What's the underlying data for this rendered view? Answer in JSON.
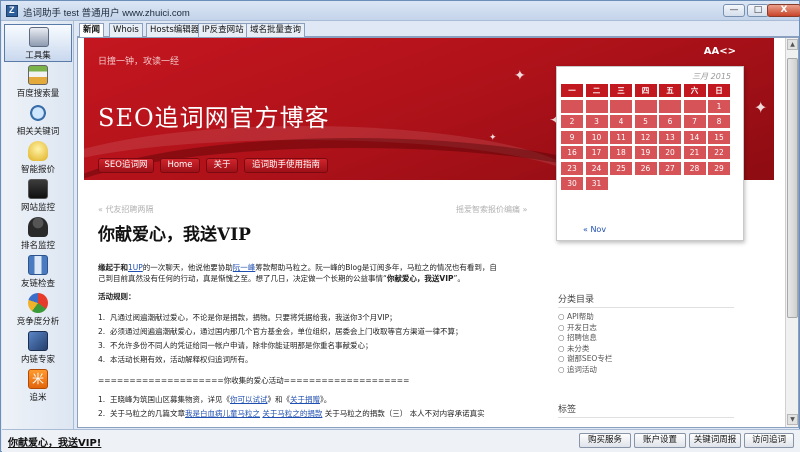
{
  "window": {
    "title": "追词助手 test 普通用户 www.zhuici.com",
    "controls": [
      "—",
      "□",
      "X"
    ]
  },
  "sidebar": {
    "items": [
      {
        "label": "工具集",
        "icon": "toolbox-icon"
      },
      {
        "label": "百度搜索量",
        "icon": "chart-icon"
      },
      {
        "label": "相关关键词",
        "icon": "magnifier-icon"
      },
      {
        "label": "智能报价",
        "icon": "lightbulb-icon"
      },
      {
        "label": "网站监控",
        "icon": "monitor-icon"
      },
      {
        "label": "排名监控",
        "icon": "user-icon"
      },
      {
        "label": "友链检查",
        "icon": "network-icon"
      },
      {
        "label": "竞争度分析",
        "icon": "pie-icon"
      },
      {
        "label": "内链专家",
        "icon": "links-icon"
      },
      {
        "label": "追米",
        "icon": "rice-icon"
      }
    ]
  },
  "tabs": [
    "新闻",
    "Whois",
    "Hosts编辑器",
    "IP反查网站",
    "域名批量查询"
  ],
  "blog": {
    "slogan": "日撞一钟，攻读一经",
    "title": "SEO追词网官方博客",
    "font_toggle": "AA<>",
    "nav": [
      "SEO追词网",
      "Home",
      "关于",
      "追词助手使用指南"
    ]
  },
  "article": {
    "prev": "« 代友招聘两隔",
    "next": "摇爱智索报价编痛 »",
    "title": "你献爱心，我送VIP",
    "intro_a": "缘起于和",
    "intro_link1": "1UP",
    "intro_b": "的一次聊天，他说他要协助",
    "intro_link2": "阮一峰",
    "intro_c": "筹款帮助马粒之。阮一峰的Blog是订阅多年，马粒之的情况也有看到，自",
    "intro_line2_a": "己到目前真然没有任何的行动，真是惭愧之至。想了几日，决定做一个长期的公益事情“",
    "intro_line2_b": "你献爱心，我送VIP",
    "intro_line2_c": "”。",
    "rules_title": "活动规则：",
    "rules": [
      "凡通过阅遍潮献过爱心，不论是你是捐款，捐物。只要将凭据给我，我送你3个月VIP；",
      "必须通过阅遍遍潮献爱心，通过国内那几个官方基金会，单位组织，居委会上门收取等官方渠道一律不算；",
      "不允许多份不同人的凭证给同一帐户申请，除非你能证明那是你重名事献爱心；",
      "本活动长期有效，活动解释权归追词所有。"
    ],
    "divider": "====================你收集的爱心活动====================",
    "donations": [
      {
        "a": "王晓峰为筑国山区募集物资，详见《",
        "link": "你可以试试",
        "b": "》和《",
        "link2": "关于捐赠",
        "c": "》。"
      },
      {
        "a": "关于马粒之的几篇文章",
        "link": "我是白血病儿童马粒之",
        "b": "  ",
        "link2": "关于马粒之的捐款",
        "c": "  关于马粒之的捐款（三）  本人不对内容承诺真实"
      }
    ]
  },
  "calendar": {
    "caption": "三月 2015",
    "weekdays": [
      "一",
      "二",
      "三",
      "四",
      "五",
      "六",
      "日"
    ],
    "days": [
      "",
      "",
      "",
      "",
      "",
      "",
      "1",
      "2",
      "3",
      "4",
      "5",
      "6",
      "7",
      "8",
      "9",
      "10",
      "11",
      "12",
      "13",
      "14",
      "15",
      "16",
      "17",
      "18",
      "19",
      "20",
      "21",
      "22",
      "23",
      "24",
      "25",
      "26",
      "27",
      "28",
      "29",
      "30",
      "31"
    ],
    "prev_link": "« Nov"
  },
  "categories": {
    "heading": "分类目录",
    "items": [
      "API帮助",
      "开发日志",
      "招聘信息",
      "未分类",
      "谢那SEO专栏",
      "追词活动"
    ]
  },
  "tags": {
    "heading": "标签"
  },
  "status": {
    "message": "你献爱心，我送VIP!",
    "buttons": [
      "购买服务",
      "账户设置",
      "关键词周报",
      "访问追词"
    ]
  },
  "colors": {
    "banner_red": "#c41620",
    "calendar_cell": "#d65358",
    "link_blue": "#1f4fb0"
  }
}
